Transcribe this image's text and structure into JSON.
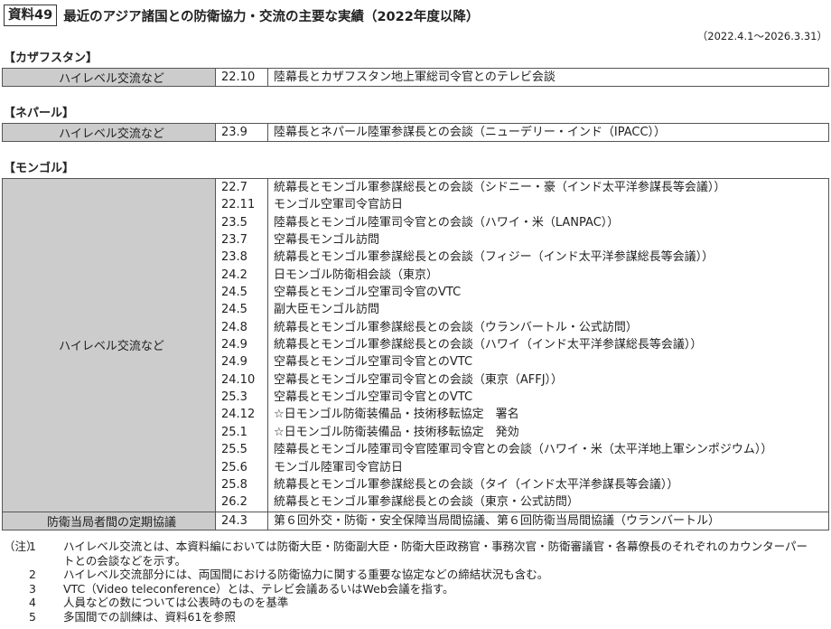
{
  "header": {
    "badge": "資料49",
    "title": "最近のアジア諸国との防衛協力・交流の主要な実績（2022年度以降）",
    "period": "（2022.4.1～2026.3.31）"
  },
  "sections": [
    {
      "heading": "【カザフスタン】",
      "rows": [
        {
          "category": "ハイレベル交流など",
          "items": [
            {
              "date": "22.10",
              "text": "陸幕長とカザフスタン地上軍総司令官とのテレビ会談"
            }
          ]
        }
      ]
    },
    {
      "heading": "【ネパール】",
      "rows": [
        {
          "category": "ハイレベル交流など",
          "items": [
            {
              "date": "23.9",
              "text": "陸幕長とネパール陸軍参謀長との会談（ニューデリー・インド（IPACC））"
            }
          ]
        }
      ]
    },
    {
      "heading": "【モンゴル】",
      "rows": [
        {
          "category": "ハイレベル交流など",
          "items": [
            {
              "date": "22.7",
              "text": "統幕長とモンゴル軍参謀総長との会談（シドニー・豪（インド太平洋参謀長等会議））"
            },
            {
              "date": "22.11",
              "text": "モンゴル空軍司令官訪日"
            },
            {
              "date": "23.5",
              "text": "陸幕長とモンゴル陸軍司令官との会談（ハワイ・米（LANPAC））"
            },
            {
              "date": "23.7",
              "text": "空幕長モンゴル訪問"
            },
            {
              "date": "23.8",
              "text": "統幕長とモンゴル軍参謀総長との会談（フィジー（インド太平洋参謀総長等会議））"
            },
            {
              "date": "24.2",
              "text": "日モンゴル防衛相会談（東京）"
            },
            {
              "date": "24.5",
              "text": "空幕長とモンゴル空軍司令官のVTC"
            },
            {
              "date": "24.5",
              "text": "副大臣モンゴル訪問"
            },
            {
              "date": "24.8",
              "text": "統幕長とモンゴル軍参謀総長との会談（ウランバートル・公式訪問）"
            },
            {
              "date": "24.9",
              "text": "統幕長とモンゴル軍参謀総長との会談（ハワイ（インド太平洋参謀総長等会議））"
            },
            {
              "date": "24.9",
              "text": "空幕長とモンゴル空軍司令官とのVTC"
            },
            {
              "date": "24.10",
              "text": "空幕長とモンゴル空軍司令官との会談（東京（AFFJ））"
            },
            {
              "date": "25.3",
              "text": "空幕長とモンゴル空軍司令官とのVTC"
            },
            {
              "date": "24.12",
              "text": "☆日モンゴル防衛装備品・技術移転協定　署名"
            },
            {
              "date": "25.1",
              "text": "☆日モンゴル防衛装備品・技術移転協定　発効"
            },
            {
              "date": "25.5",
              "text": "陸幕長とモンゴル陸軍司令官陸軍司令官との会談（ハワイ・米（太平洋地上軍シンポジウム））"
            },
            {
              "date": "25.6",
              "text": "モンゴル陸軍司令官訪日"
            },
            {
              "date": "25.8",
              "text": "統幕長とモンゴル軍参謀総長との会談（タイ（インド太平洋参謀長等会議））"
            },
            {
              "date": "26.2",
              "text": "統幕長とモンゴル軍参謀総長との会談（東京・公式訪問）"
            }
          ]
        },
        {
          "category": "防衛当局者間の定期協議",
          "items": [
            {
              "date": "24.3",
              "text": "第６回外交・防衛・安全保障当局間協議、第６回防衛当局間協議（ウランバートル）"
            }
          ]
        }
      ]
    }
  ],
  "notes": {
    "lead": "（注）",
    "items": [
      {
        "num": "1",
        "text": "ハイレベル交流とは、本資料編においては防衛大臣・防衛副大臣・防衛大臣政務官・事務次官・防衛審議官・各幕僚長のそれぞれのカウンターパートとの会談などを示す。"
      },
      {
        "num": "2",
        "text": "ハイレベル交流部分には、両国間における防衛協力に関する重要な協定などの締結状況も含む。"
      },
      {
        "num": "3",
        "text": "VTC（Video teleconference）とは、テレビ会議あるいはWeb会議を指す。"
      },
      {
        "num": "4",
        "text": "人員などの数については公表時のものを基準"
      },
      {
        "num": "5",
        "text": "多国間での訓練は、資料61を参照"
      }
    ]
  }
}
